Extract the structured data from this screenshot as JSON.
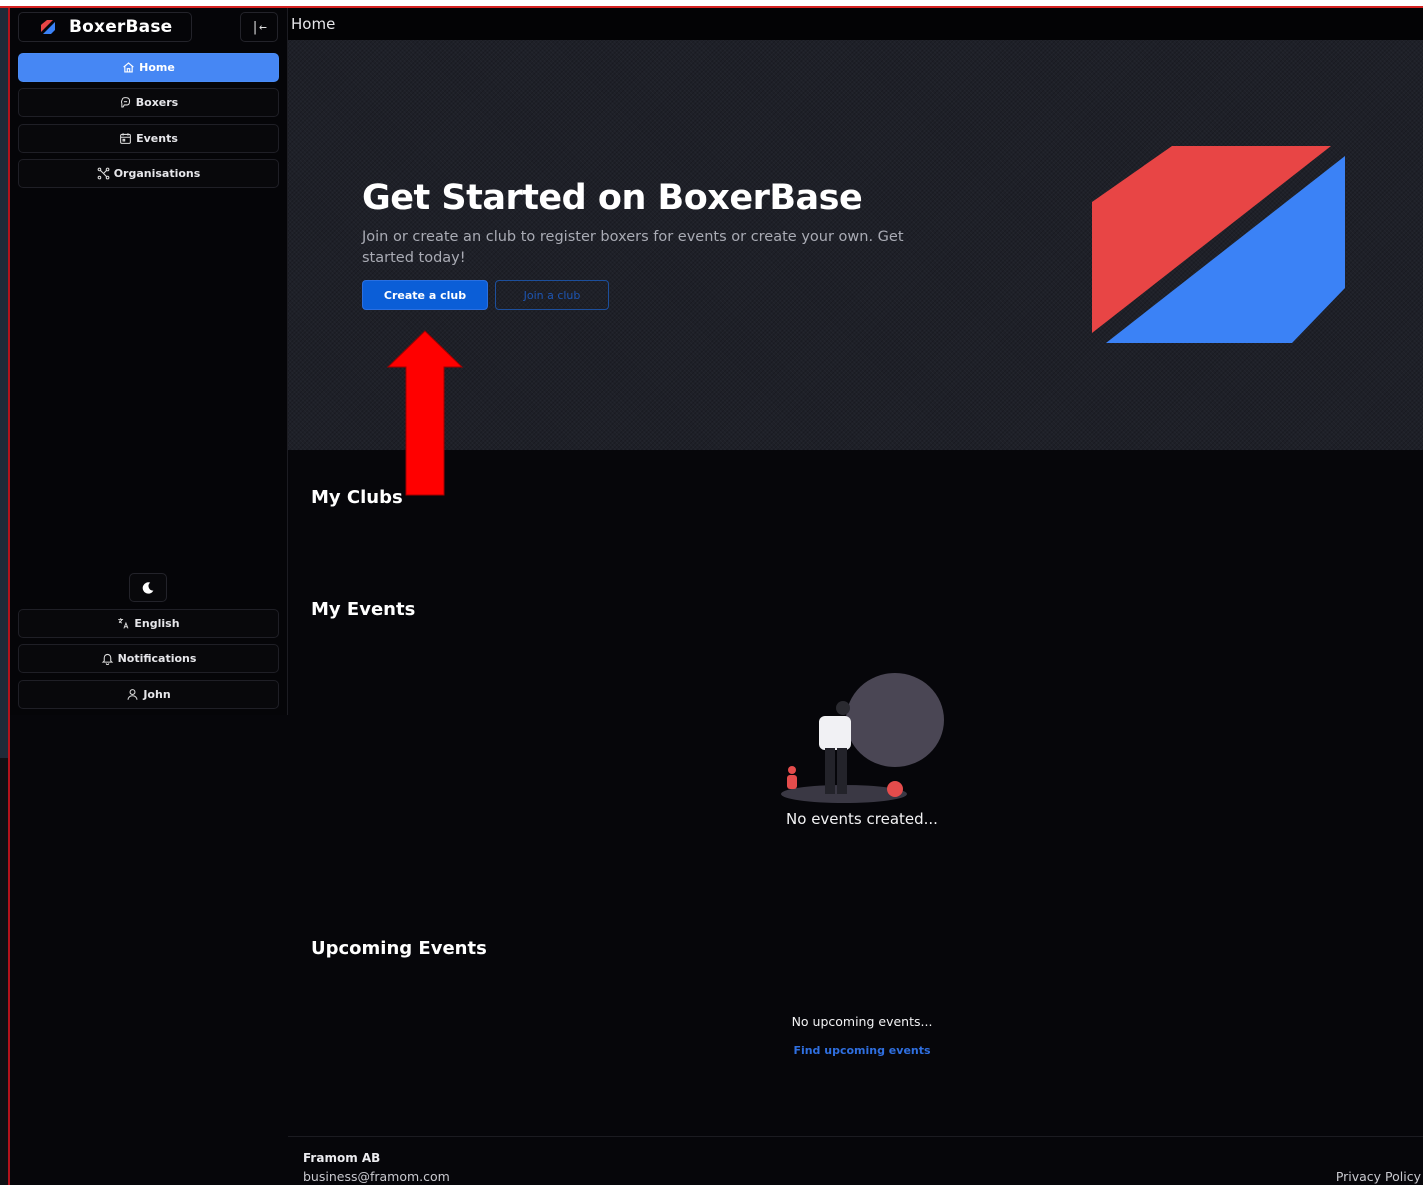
{
  "app": {
    "name": "BoxerBase",
    "collapse_icon": "|←"
  },
  "sidebar": {
    "nav": [
      {
        "label": "Home",
        "icon": "home-icon",
        "active": true
      },
      {
        "label": "Boxers",
        "icon": "boxing-glove-icon",
        "active": false
      },
      {
        "label": "Events",
        "icon": "calendar-icon",
        "active": false
      },
      {
        "label": "Organisations",
        "icon": "network-icon",
        "active": false
      }
    ],
    "theme_toggle_icon": "moon-icon",
    "bottom": [
      {
        "label": "English",
        "icon": "translate-icon"
      },
      {
        "label": "Notifications",
        "icon": "bell-icon"
      },
      {
        "label": "John",
        "icon": "user-icon"
      }
    ]
  },
  "topbar": {
    "title": "Home"
  },
  "hero": {
    "title": "Get Started on BoxerBase",
    "subtitle": "Join or create an club to register boxers for events or create your own. Get started today!",
    "create_button": "Create a club",
    "join_button": "Join a club"
  },
  "sections": {
    "my_clubs": {
      "title": "My Clubs"
    },
    "my_events": {
      "title": "My Events",
      "empty_text": "No events created..."
    },
    "upcoming_events": {
      "title": "Upcoming Events",
      "empty_text": "No upcoming events...",
      "link": "Find upcoming events"
    }
  },
  "footer": {
    "company": "Framom AB",
    "email": "business@framom.com",
    "privacy": "Privacy Policy"
  },
  "colors": {
    "accent": "#4687f4",
    "primary_button": "#0b5ed7",
    "logo_red": "#e84545",
    "logo_blue": "#3b82f6",
    "annotation_arrow": "#ff0000"
  }
}
